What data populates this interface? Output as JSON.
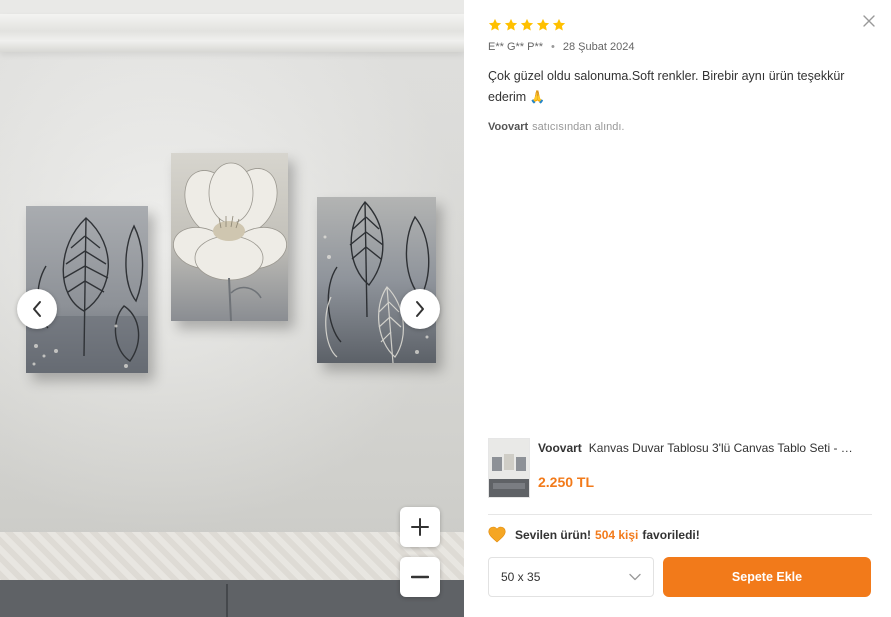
{
  "review": {
    "rating": 5,
    "max_rating": 5,
    "author": "E** G** P**",
    "date": "28 Şubat 2024",
    "text": "Çok güzel oldu salonuma.Soft renkler. Birebir aynı ürün teşekkür ederim 🙏",
    "seller_name": "Voovart",
    "seller_suffix": "satıcısından alındı."
  },
  "product": {
    "brand": "Voovart",
    "title": "Kanvas Duvar Tablosu 3'lü Canvas Tablo Seti - …",
    "price": "2.250 TL"
  },
  "favorite": {
    "prefix": "Sevilen ürün!",
    "count": "504 kişi",
    "suffix": "favoriledi!"
  },
  "size_select": {
    "value": "50 x 35"
  },
  "add_to_cart": {
    "label": "Sepete Ekle"
  },
  "icons": {
    "close": "close-icon",
    "star": "star-icon",
    "prev": "chevron-left-icon",
    "next": "chevron-right-icon",
    "zoom_in": "plus-icon",
    "zoom_out": "minus-icon",
    "heart": "heart-icon",
    "chevron": "chevron-down-icon"
  },
  "colors": {
    "accent": "#f27a1a",
    "star": "#ffc000"
  }
}
